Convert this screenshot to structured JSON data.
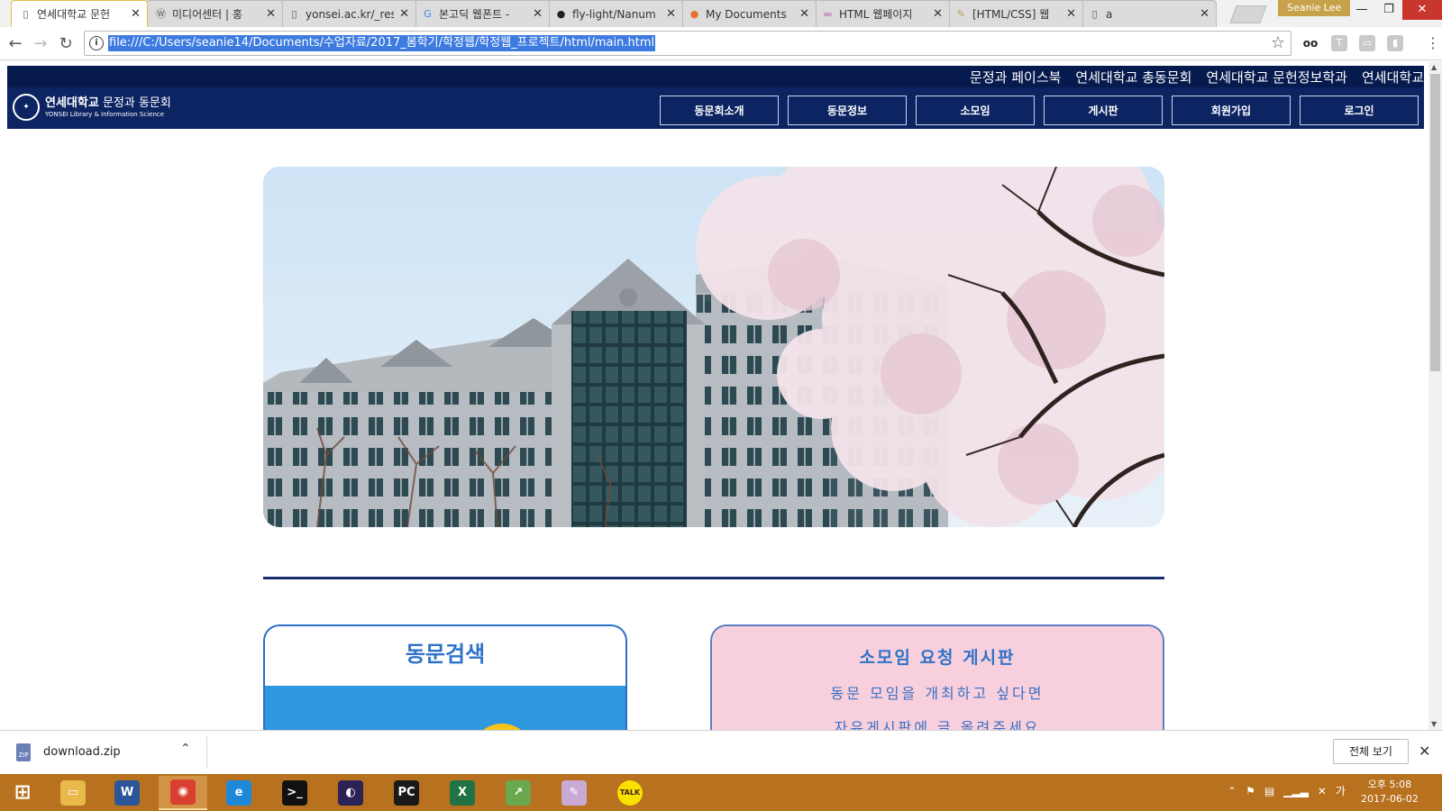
{
  "browser": {
    "tabs": [
      {
        "label": "연세대학교 문헌",
        "favicon": "page-icon",
        "active": true
      },
      {
        "label": "미디어센터 | 홍",
        "favicon": "wordpress-icon",
        "active": false
      },
      {
        "label": "yonsei.ac.kr/_res",
        "favicon": "page-icon",
        "active": false
      },
      {
        "label": "본고딕 웹폰트 -",
        "favicon": "google-icon",
        "active": false
      },
      {
        "label": "fly-light/Nanum",
        "favicon": "github-icon",
        "active": false
      },
      {
        "label": "My Documents",
        "favicon": "orange-circle-icon",
        "active": false
      },
      {
        "label": "HTML 웹페이지",
        "favicon": "flag-icon",
        "active": false
      },
      {
        "label": "[HTML/CSS] 웹",
        "favicon": "scroll-icon",
        "active": false
      },
      {
        "label": "a",
        "favicon": "page-icon",
        "active": false
      }
    ],
    "profile_name": "Seanie Lee",
    "url": "file:///C:/Users/seanie14/Documents/수업자료/2017_봄학기/학정웹/학정웹_프로젝트/html/main.html",
    "extensions": [
      {
        "icon": "glasses-icon",
        "glyph": "oo"
      },
      {
        "icon": "translate-icon",
        "glyph": "T"
      },
      {
        "icon": "cast-icon",
        "glyph": "▭"
      },
      {
        "icon": "extension-icon",
        "glyph": "▮"
      }
    ]
  },
  "site": {
    "top_links": [
      "문정과 페이스북",
      "연세대학교 총동문회",
      "연세대학교 문헌정보학과",
      "연세대학교"
    ],
    "logo_title_bold": "연세대학교",
    "logo_title_rest": " 문정과 동문회",
    "logo_subtitle": "YONSEI Library & Information Science",
    "nav": [
      "동문회소개",
      "동문정보",
      "소모임",
      "게시판",
      "회원가입",
      "로그인"
    ],
    "search_card": {
      "title": "동문검색"
    },
    "board_card": {
      "title": "소모임 요청 게시판",
      "lines": [
        "동문 모임을 개최하고 싶다면",
        "자유게시판에 글 올려주세요"
      ]
    }
  },
  "downloads": {
    "file_name": "download.zip",
    "show_all_label": "전체 보기"
  },
  "taskbar": {
    "apps": [
      {
        "name": "start",
        "glyph": "⊞",
        "color": "#ffffff"
      },
      {
        "name": "file-explorer",
        "glyph": "▭",
        "color": "#e8b84a"
      },
      {
        "name": "word",
        "glyph": "W",
        "color": "#2b579a"
      },
      {
        "name": "chrome",
        "glyph": "◉",
        "color": "#d8412f"
      },
      {
        "name": "internet-explorer",
        "glyph": "e",
        "color": "#1e88d8"
      },
      {
        "name": "command-prompt",
        "glyph": ">_",
        "color": "#111111"
      },
      {
        "name": "eclipse",
        "glyph": "◐",
        "color": "#2c2255"
      },
      {
        "name": "pycharm",
        "glyph": "PC",
        "color": "#1a1a1a"
      },
      {
        "name": "excel",
        "glyph": "X",
        "color": "#217346"
      },
      {
        "name": "chart-app",
        "glyph": "↗",
        "color": "#6aa84f"
      },
      {
        "name": "paint",
        "glyph": "✎",
        "color": "#c9a9d6"
      },
      {
        "name": "kakaotalk",
        "glyph": "TALK",
        "color": "#f9e000"
      }
    ],
    "tray_time": "오후 5:08",
    "tray_date": "2017-06-02",
    "tray_ime": "가"
  }
}
